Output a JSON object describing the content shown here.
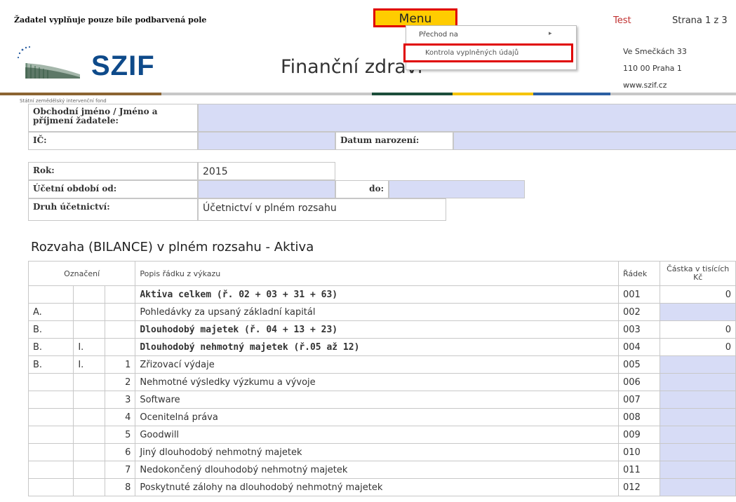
{
  "topbar": {
    "note": "Žadatel vyplňuje pouze bíle podbarvená pole",
    "menu_label": "Menu",
    "test_label": "Test",
    "page_label": "Strana 1 z 3"
  },
  "dropdown": {
    "items": [
      {
        "label": "Přechod na",
        "submenu": true
      },
      {
        "label": "Kontrola vyplněných údajů",
        "submenu": false
      }
    ]
  },
  "header": {
    "logo_text": "SZIF",
    "logo_subtitle": "Státní zemědělský intervenční fond",
    "title": "Finanční zdraví",
    "address_line1": "Ve Smečkách 33",
    "address_line2": "110 00 Praha 1",
    "address_line3": "www.szif.cz"
  },
  "form": {
    "obchodni_label": "Obchodní jméno / Jméno a příjmení žadatele:",
    "ic_label": "IČ:",
    "datum_label": "Datum narození:",
    "rok_label": "Rok:",
    "rok_value": "2015",
    "obdobi_od_label": "Účetní období od:",
    "do_label": "do:",
    "druh_label": "Druh účetnictví:",
    "druh_value": "Účetnictví v plném rozsahu"
  },
  "section_title": "Rozvaha (BILANCE) v plném rozsahu - Aktiva",
  "table": {
    "headers": {
      "oznaceni": "Označení",
      "popis": "Popis řádku z výkazu",
      "radek": "Řádek",
      "castka": "Částka v tisících Kč"
    },
    "rows": [
      {
        "a": "",
        "b": "",
        "c": "",
        "popis": "Aktiva celkem (ř. 02 + 03 + 31 + 63)",
        "radek": "001",
        "castka": "0",
        "bold": true,
        "input": false
      },
      {
        "a": "A.",
        "b": "",
        "c": "",
        "popis": "Pohledávky za upsaný základní kapitál",
        "radek": "002",
        "castka": "",
        "bold": false,
        "input": true
      },
      {
        "a": "B.",
        "b": "",
        "c": "",
        "popis": "Dlouhodobý majetek (ř. 04 + 13 + 23)",
        "radek": "003",
        "castka": "0",
        "bold": true,
        "input": false
      },
      {
        "a": "B.",
        "b": "I.",
        "c": "",
        "popis": "Dlouhodobý nehmotný majetek (ř.05 až 12)",
        "radek": "004",
        "castka": "0",
        "bold": true,
        "input": false
      },
      {
        "a": "B.",
        "b": "I.",
        "c": "1",
        "popis": "Zřizovací výdaje",
        "radek": "005",
        "castka": "",
        "bold": false,
        "input": true
      },
      {
        "a": "",
        "b": "",
        "c": "2",
        "popis": "Nehmotné výsledky výzkumu a vývoje",
        "radek": "006",
        "castka": "",
        "bold": false,
        "input": true
      },
      {
        "a": "",
        "b": "",
        "c": "3",
        "popis": "Software",
        "radek": "007",
        "castka": "",
        "bold": false,
        "input": true
      },
      {
        "a": "",
        "b": "",
        "c": "4",
        "popis": "Ocenitelná práva",
        "radek": "008",
        "castka": "",
        "bold": false,
        "input": true
      },
      {
        "a": "",
        "b": "",
        "c": "5",
        "popis": "Goodwill",
        "radek": "009",
        "castka": "",
        "bold": false,
        "input": true
      },
      {
        "a": "",
        "b": "",
        "c": "6",
        "popis": "Jiný dlouhodobý nehmotný majetek",
        "radek": "010",
        "castka": "",
        "bold": false,
        "input": true
      },
      {
        "a": "",
        "b": "",
        "c": "7",
        "popis": "Nedokončený dlouhodobý nehmotný majetek",
        "radek": "011",
        "castka": "",
        "bold": false,
        "input": true
      },
      {
        "a": "",
        "b": "",
        "c": "8",
        "popis": "Poskytnuté zálohy na dlouhodobý nehmotný majetek",
        "radek": "012",
        "castka": "",
        "bold": false,
        "input": true
      }
    ]
  }
}
